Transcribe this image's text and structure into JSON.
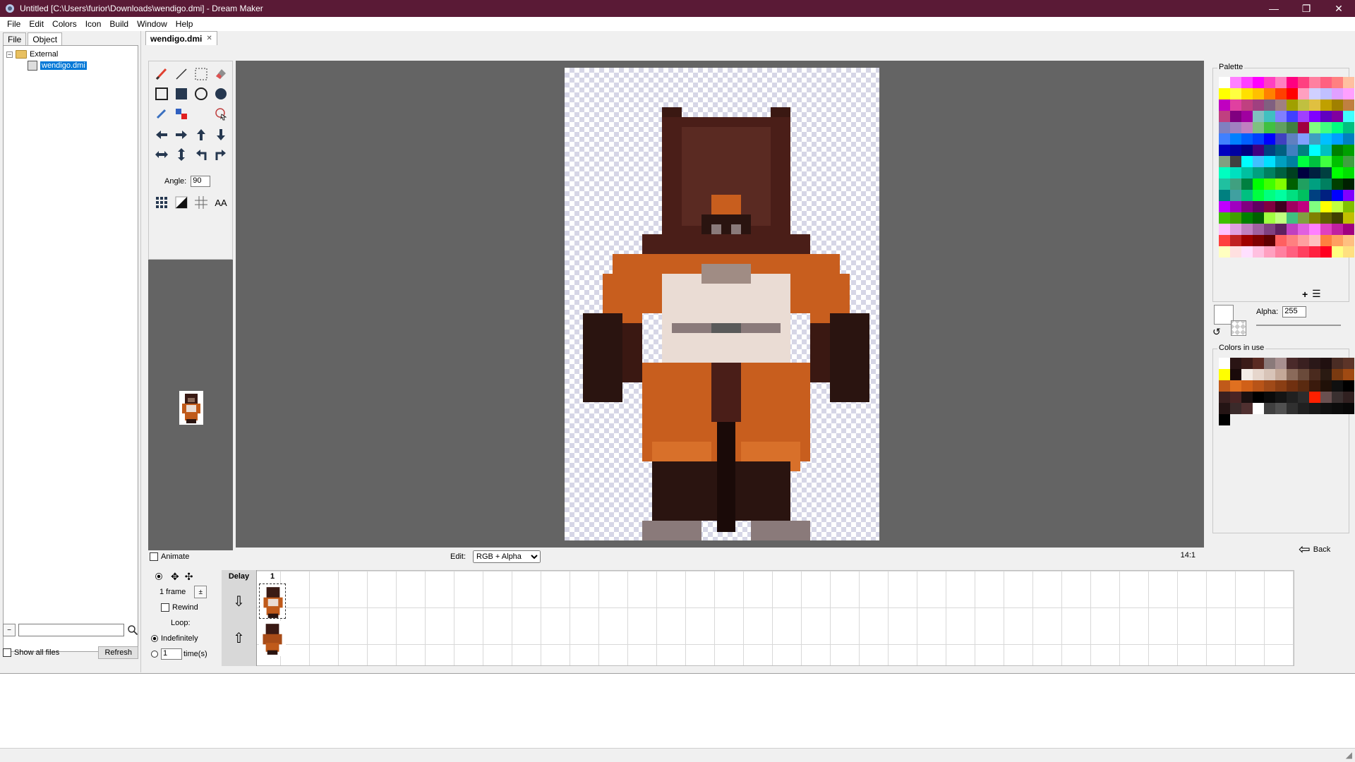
{
  "window": {
    "title": "Untitled [C:\\Users\\furior\\Downloads\\wendigo.dmi] - Dream Maker",
    "minimize": "—",
    "maximize": "❐",
    "close": "✕"
  },
  "menu": [
    "File",
    "Edit",
    "Colors",
    "Icon",
    "Build",
    "Window",
    "Help"
  ],
  "left": {
    "tabs": [
      "File",
      "Object"
    ],
    "tree": {
      "root": "External",
      "child": "wendigo.dmi"
    },
    "show_all_files": "Show all files",
    "refresh": "Refresh"
  },
  "editor": {
    "tab": "wendigo.dmi",
    "angle_label": "Angle:",
    "angle_value": "90",
    "aa_label": "AA",
    "animate_label": "Animate",
    "edit_label": "Edit:",
    "edit_mode": "RGB + Alpha",
    "zoom": "14:1"
  },
  "animation": {
    "frames_label": "1 frame",
    "rewind": "Rewind",
    "loop": "Loop:",
    "indefinitely": "Indefinitely",
    "times_value": "1",
    "times_label": "time(s)",
    "delay_header": "Delay",
    "frame_header": "1"
  },
  "right": {
    "palette_label": "Palette",
    "alpha_label": "Alpha:",
    "alpha_value": "255",
    "colors_in_use_label": "Colors in use",
    "back": "Back"
  },
  "colors": {
    "titlebar": "#5a1a36",
    "canvas_bg": "#646464",
    "selection": "#0078d7",
    "palette": [
      "#ffffff",
      "#ff80ff",
      "#ff40ff",
      "#ff00ff",
      "#ff40c0",
      "#ff80c0",
      "#ff0080",
      "#ff4080",
      "#ff80a0",
      "#ff6080",
      "#ff8080",
      "#ffc0a0",
      "#ffff00",
      "#ffff40",
      "#ffe000",
      "#ffc000",
      "#ff8000",
      "#ff4000",
      "#ff0000",
      "#ffa0c0",
      "#d0d0ff",
      "#c0c0ff",
      "#e0a0ff",
      "#ffa0ff",
      "#c000c0",
      "#e040a0",
      "#c04080",
      "#a04080",
      "#806080",
      "#a08080",
      "#a0a000",
      "#c0c040",
      "#e0c040",
      "#c0a000",
      "#a08000",
      "#c08040",
      "#c04080",
      "#800080",
      "#a000a0",
      "#80c0c0",
      "#40c0c0",
      "#8080ff",
      "#4040ff",
      "#a040ff",
      "#8000ff",
      "#6000c0",
      "#8000a0",
      "#40ffff",
      "#8080c0",
      "#a080c0",
      "#c080c0",
      "#80c080",
      "#40c040",
      "#60a060",
      "#408040",
      "#a00040",
      "#80ff80",
      "#40ff80",
      "#00ff80",
      "#00c080",
      "#4080ff",
      "#0080ff",
      "#0060ff",
      "#0040ff",
      "#0000ff",
      "#4040c0",
      "#6080c0",
      "#80a0ff",
      "#40a0c0",
      "#00c0ff",
      "#00a0ff",
      "#0080c0",
      "#0000c0",
      "#0000a0",
      "#000080",
      "#400080",
      "#004080",
      "#006080",
      "#4080c0",
      "#008080",
      "#00ffff",
      "#00c0c0",
      "#008000",
      "#00a000",
      "#80a080",
      "#404040",
      "#00ffff",
      "#40c0ff",
      "#00e0ff",
      "#00a0c0",
      "#0080a0",
      "#00ff40",
      "#00c040",
      "#40ff40",
      "#00c000",
      "#40a040",
      "#00ffc0",
      "#00e0c0",
      "#00c0a0",
      "#00a080",
      "#008060",
      "#006040",
      "#004020",
      "#000040",
      "#002040",
      "#004040",
      "#00ff00",
      "#00e000",
      "#20c0a0",
      "#40a080",
      "#008040",
      "#00ff00",
      "#40ff00",
      "#80ff00",
      "#006000",
      "#20a060",
      "#00a080",
      "#008060",
      "#004000",
      "#002000",
      "#008080",
      "#40a0a0",
      "#00c080",
      "#00ff40",
      "#00ff80",
      "#00ffa0",
      "#00e080",
      "#00c060",
      "#004080",
      "#002080",
      "#0000ff",
      "#8000ff",
      "#c000ff",
      "#a000c0",
      "#800080",
      "#600060",
      "#800040",
      "#400020",
      "#a00060",
      "#c00080",
      "#80ff80",
      "#ffff00",
      "#c0ff40",
      "#80c000",
      "#40c000",
      "#40a000",
      "#008000",
      "#006000",
      "#a0ff40",
      "#c0ff80",
      "#40c080",
      "#80a040",
      "#808000",
      "#606000",
      "#404000",
      "#c0c000",
      "#ffc0ff",
      "#e0a0e0",
      "#c080c0",
      "#a060a0",
      "#804080",
      "#602060",
      "#c040c0",
      "#e060e0",
      "#ff80ff",
      "#e040c0",
      "#c020a0",
      "#a00080",
      "#ff4040",
      "#c02020",
      "#a00000",
      "#800000",
      "#600000",
      "#ff6060",
      "#ff8080",
      "#ffa0a0",
      "#ffc0c0",
      "#ff8040",
      "#ffa060",
      "#ffc080",
      "#ffffc0",
      "#ffe0e0",
      "#ffe0ff",
      "#ffc0e0",
      "#ffa0c0",
      "#ff80a0",
      "#ff6080",
      "#ff4060",
      "#ff2040",
      "#ff0020",
      "#ffff80",
      "#ffe080"
    ],
    "in_use": [
      "#ffffff",
      "#2a1414",
      "#3b1b18",
      "#5a2a22",
      "#8a7a7a",
      "#a89090",
      "#4a2a2a",
      "#3a2020",
      "#2a1818",
      "#201010",
      "#4a2c24",
      "#5c3428",
      "#ffff00",
      "#1a0a0a",
      "#f4ece6",
      "#e6d6cc",
      "#d8c4b8",
      "#c4a898",
      "#8a6a5a",
      "#6a4a3a",
      "#4a2a1e",
      "#2a1a12",
      "#7a3a10",
      "#a04a12",
      "#c05a1a",
      "#e07020",
      "#d06018",
      "#b85418",
      "#a04a18",
      "#8a3e14",
      "#703010",
      "#5a2a10",
      "#3a1a0c",
      "#201008",
      "#101010",
      "#000000",
      "#3a2020",
      "#4a2424",
      "#1a1010",
      "#000000",
      "#0a0a0a",
      "#141414",
      "#202020",
      "#2c2c2c",
      "#ff2000",
      "#6a5050",
      "#3a3030",
      "#302020",
      "#241414",
      "#3a2a2a",
      "#503030",
      "#ffffff",
      "#404040",
      "#505050",
      "#303030",
      "#202020",
      "#181818",
      "#101010",
      "#0c0c0c",
      "#080808",
      "#000000"
    ]
  }
}
